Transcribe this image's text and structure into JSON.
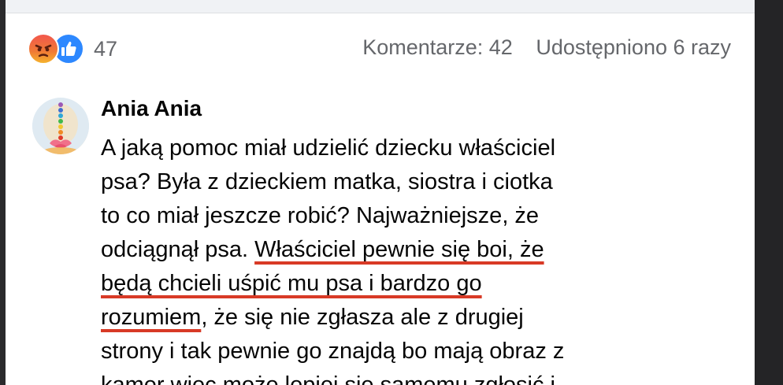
{
  "reactions": {
    "icons": [
      "angry-icon",
      "like-icon"
    ],
    "count": "47"
  },
  "stats": {
    "comments": "Komentarze: 42",
    "shares": "Udostępniono 6 razy"
  },
  "comment": {
    "author": "Ania Ania",
    "lines": [
      {
        "plain": "A jaką pomoc miał udzielić dziecku właściciel"
      },
      {
        "plain": "psa? Była z dzieckiem matka, siostra i ciotka"
      },
      {
        "plain": "to co miał jeszcze robić? Najważniejsze, że"
      },
      {
        "plain": "odciągnął psa. ",
        "underlined": "Właściciel pewnie się boi, że"
      },
      {
        "underlined": "będą chcieli uśpić mu psa i bardzo go"
      },
      {
        "underlined": "rozumiem",
        "plain": ", że się nie zgłasza ale z drugiej"
      },
      {
        "plain": "strony i tak pewnie go znajdą bo mają obraz z"
      },
      {
        "plain": "kamer więc może lepiej się samemu zgłosić i"
      }
    ]
  },
  "colors": {
    "underline": "#d83a26",
    "secondary_text": "#65676b",
    "like_blue": "#2d88ff"
  }
}
